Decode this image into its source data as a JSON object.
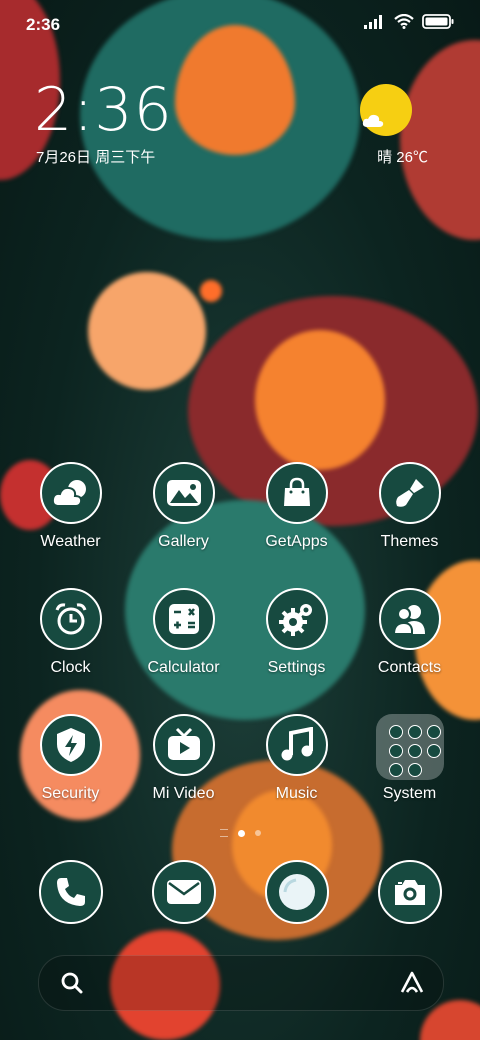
{
  "status_bar": {
    "time": "2:36"
  },
  "clock_widget": {
    "time": "2:36",
    "date": "7月26日 周三下午"
  },
  "weather_widget": {
    "text": "晴 26℃"
  },
  "apps": [
    {
      "label": "Weather",
      "icon": "weather-icon"
    },
    {
      "label": "Gallery",
      "icon": "gallery-icon"
    },
    {
      "label": "GetApps",
      "icon": "shopping-bag-icon"
    },
    {
      "label": "Themes",
      "icon": "paintbrush-icon"
    },
    {
      "label": "Clock",
      "icon": "alarm-clock-icon"
    },
    {
      "label": "Calculator",
      "icon": "calculator-icon"
    },
    {
      "label": "Settings",
      "icon": "gears-icon"
    },
    {
      "label": "Contacts",
      "icon": "contacts-icon"
    },
    {
      "label": "Security",
      "icon": "shield-bolt-icon"
    },
    {
      "label": "Mi Video",
      "icon": "tv-play-icon"
    },
    {
      "label": "Music",
      "icon": "music-note-icon"
    },
    {
      "label": "System",
      "icon": "folder-icon"
    }
  ],
  "dock": [
    {
      "icon": "phone-icon"
    },
    {
      "icon": "mail-icon"
    },
    {
      "icon": "browser-icon"
    },
    {
      "icon": "camera-icon"
    }
  ],
  "colors": {
    "icon_bg": "#174a40",
    "sun": "#f6cf12"
  }
}
